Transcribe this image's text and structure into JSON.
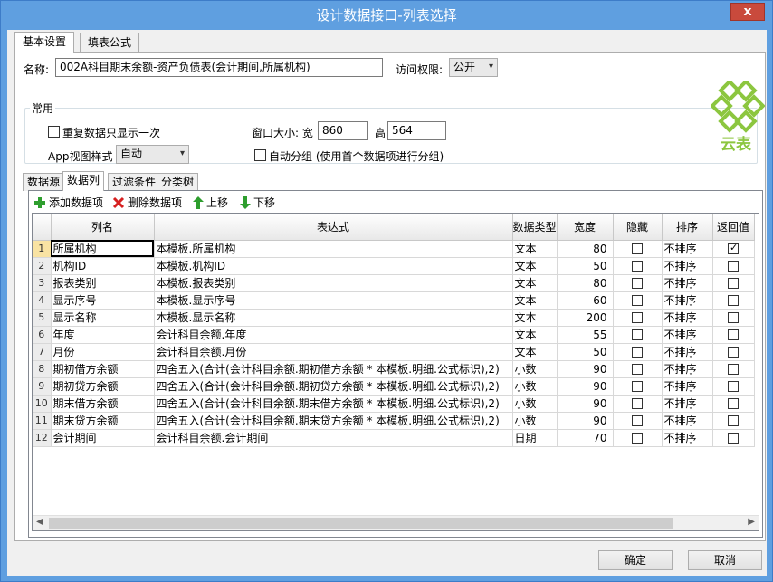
{
  "window": {
    "title": "设计数据接口-列表选择",
    "close_label": "x"
  },
  "top_tabs": [
    {
      "label": "基本设置",
      "active": true
    },
    {
      "label": "填表公式",
      "active": false
    }
  ],
  "form": {
    "name_label": "名称:",
    "name_value": "002A科目期末余额-资产负债表(会计期间,所属机构)",
    "access_label": "访问权限:",
    "access_value": "公开",
    "group_title": "常用",
    "repeat_label": "重复数据只显示一次",
    "window_size_label": "窗口大小: 宽",
    "width_value": "860",
    "height_label": "高",
    "height_value": "564",
    "app_view_label": "App视图样式",
    "app_view_value": "自动",
    "auto_group_label": "自动分组 (使用首个数据项进行分组)"
  },
  "logo": {
    "text": "云表",
    "color": "#8cc63f"
  },
  "inner_tabs": [
    {
      "label": "数据源",
      "active": false
    },
    {
      "label": "数据列",
      "active": true
    },
    {
      "label": "过滤条件",
      "active": false
    },
    {
      "label": "分类树",
      "active": false
    }
  ],
  "toolbar": {
    "add": "添加数据项",
    "delete": "删除数据项",
    "up": "上移",
    "down": "下移"
  },
  "grid": {
    "columns": [
      "列名",
      "表达式",
      "数据类型",
      "宽度",
      "隐藏",
      "排序",
      "返回值"
    ],
    "rows": [
      {
        "n": "1",
        "name": "所属机构",
        "expr": "本模板.所属机构",
        "type": "文本",
        "width": "80",
        "hidden": false,
        "sort": "不排序",
        "ret": true
      },
      {
        "n": "2",
        "name": "机构ID",
        "expr": "本模板.机构ID",
        "type": "文本",
        "width": "50",
        "hidden": false,
        "sort": "不排序",
        "ret": false
      },
      {
        "n": "3",
        "name": "报表类别",
        "expr": "本模板.报表类别",
        "type": "文本",
        "width": "80",
        "hidden": false,
        "sort": "不排序",
        "ret": false
      },
      {
        "n": "4",
        "name": "显示序号",
        "expr": "本模板.显示序号",
        "type": "文本",
        "width": "60",
        "hidden": false,
        "sort": "不排序",
        "ret": false
      },
      {
        "n": "5",
        "name": "显示名称",
        "expr": "本模板.显示名称",
        "type": "文本",
        "width": "200",
        "hidden": false,
        "sort": "不排序",
        "ret": false
      },
      {
        "n": "6",
        "name": "年度",
        "expr": "会计科目余额.年度",
        "type": "文本",
        "width": "55",
        "hidden": false,
        "sort": "不排序",
        "ret": false
      },
      {
        "n": "7",
        "name": "月份",
        "expr": "会计科目余额.月份",
        "type": "文本",
        "width": "50",
        "hidden": false,
        "sort": "不排序",
        "ret": false
      },
      {
        "n": "8",
        "name": "期初借方余额",
        "expr": "四舍五入(合计(会计科目余额.期初借方余额 * 本模板.明细.公式标识),2)",
        "type": "小数",
        "width": "90",
        "hidden": false,
        "sort": "不排序",
        "ret": false
      },
      {
        "n": "9",
        "name": "期初贷方余额",
        "expr": "四舍五入(合计(会计科目余额.期初贷方余额 * 本模板.明细.公式标识),2)",
        "type": "小数",
        "width": "90",
        "hidden": false,
        "sort": "不排序",
        "ret": false
      },
      {
        "n": "10",
        "name": "期末借方余额",
        "expr": "四舍五入(合计(会计科目余额.期末借方余额 * 本模板.明细.公式标识),2)",
        "type": "小数",
        "width": "90",
        "hidden": false,
        "sort": "不排序",
        "ret": false
      },
      {
        "n": "11",
        "name": "期末贷方余额",
        "expr": "四舍五入(合计(会计科目余额.期末贷方余额 * 本模板.明细.公式标识),2)",
        "type": "小数",
        "width": "90",
        "hidden": false,
        "sort": "不排序",
        "ret": false
      },
      {
        "n": "12",
        "name": "会计期间",
        "expr": "会计科目余额.会计期间",
        "type": "日期",
        "width": "70",
        "hidden": false,
        "sort": "不排序",
        "ret": false
      }
    ]
  },
  "buttons": {
    "ok": "确定",
    "cancel": "取消"
  }
}
